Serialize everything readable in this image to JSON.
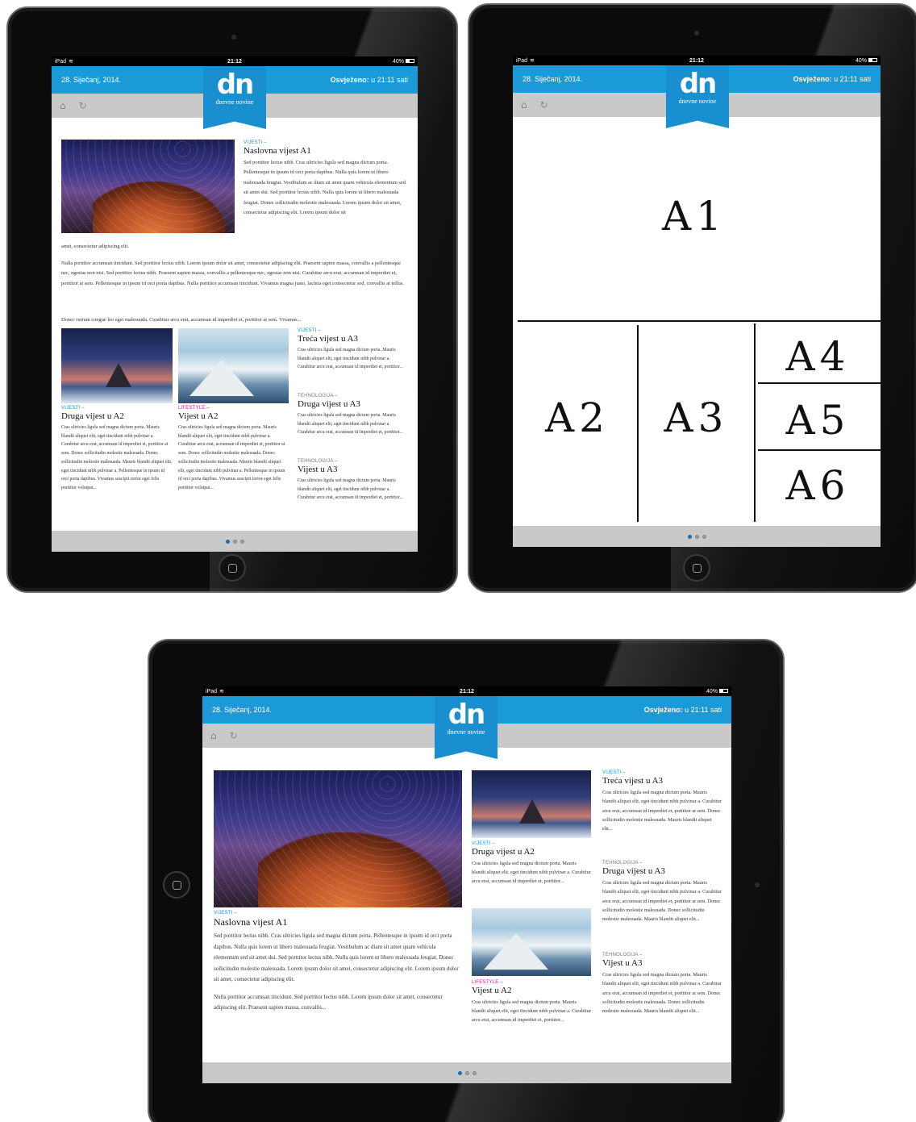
{
  "device": {
    "carrier": "iPad",
    "time": "21:12",
    "battery": "40%"
  },
  "app": {
    "date": "28. Siječanj, 2014.",
    "refresh_label": "Osvježeno:",
    "refresh_value": "u 21:11 sati",
    "logo_text": "dn",
    "logo_sub": "dnevne novine",
    "home_icon": "home-icon",
    "refresh_icon": "refresh-icon"
  },
  "articles": {
    "a1": {
      "category": "VIJESTI –",
      "title": "Naslovna vijest A1",
      "text_portrait": "Sed porttitor lectus nibh. Cras ultricies ligula sed magna dictum porta. Pellentesque in ipsum id orci porta dapibus. Nulla quis lorem ut libero malesuada feugiat. Vestibulum ac diam sit amet quam vehicula elementum sed sit amet dui. Sed porttitor lectus nibh. Nulla quis lorem ut libero malesuada feugiat. Donec sollicitudin molestie malesuada. Lorem ipsum dolor sit amet, consectetur adipiscing elit. Lorem ipsum dolor sit",
      "text_portrait_cont": "amet, consectetur adipiscing elit.",
      "para2": "Nulla porttitor accumsan tincidunt. Sed porttitor lectus nibh. Lorem ipsum dolor sit amet, consectetur adipiscing elit. Praesent sapien massa, convallis a pellentesque nec, egestas non nisi. Sed porttitor lectus nibh. Praesent sapien massa, convallis a pellentesque nec, egestas non nisi. Curabitur arcu erat, accumsan id imperdiet et, porttitor at sem. Pellentesque in ipsum id orci porta dapibus. Nulla porttitor accumsan tincidunt. Vivamus magna justo, lacinia eget consectetur sed, convallis at tellus.",
      "para3": "Donec rutrum congue leo eget malesuada. Curabitur arcu erat, accumsan id imperdiet et, porttitor at sem. Vivamus...",
      "text_landscape": "Sed porttitor lectus nibh. Cras ultricies ligula sed magna dictum porta. Pellentesque in ipsum id orci porta dapibus. Nulla quis lorem ut libero malesuada feugiat. Vestibulum ac diam sit amet quam vehicula elementum sed sit amet dui. Sed porttitor lectus nibh. Nulla quis lorem ut libero malesuada feugiat. Donec sollicitudin molestie malesuada. Lorem ipsum dolor sit amet, consectetur adipiscing elit. Lorem ipsum dolor sit amet, consectetur adipiscing elit.",
      "para2_landscape": "Nulla porttitor accumsan tincidunt. Sed porttitor lectus nibh. Lorem ipsum dolor sit amet, consectetur adipiscing elit. Praesent sapien massa, convallis..."
    },
    "druga_a2": {
      "category": "VIJESTI –",
      "title": "Druga vijest u A2",
      "text": "Cras ultricies ligula sed magna dictum porta. Mauris blandit aliquet elit, eget tincidunt nibh pulvinar a. Curabitur arcu erat, accumsan id imperdiet et, porttitor at sem. Donec sollicitudin molestie malesuada. Donec sollicitudin molestie malesuada. Mauris blandit aliquet elit, eget tincidunt nibh pulvinar a. Pellentesque in ipsum id orci porta dapibus. Vivamus suscipit tortor eget felis porttitor volutpat...",
      "text_short": "Cras ultricies ligula sed magna dictum porta. Mauris blandit aliquet elit, eget tincidunt nibh pulvinar a. Curabitur arcu erat, accumsan id imperdiet et, porttitor..."
    },
    "vijest_a2": {
      "category": "LIFESTYLE –",
      "title": "Vijest u A2",
      "text": "Cras ultricies ligula sed magna dictum porta. Mauris blandit aliquet elit, eget tincidunt nibh pulvinar a. Curabitur arcu erat, accumsan id imperdiet et, porttitor at sem. Donec sollicitudin molestie malesuada. Donec sollicitudin molestie malesuada. Mauris blandit aliquet elit, eget tincidunt nibh pulvinar a. Pellentesque in ipsum id orci porta dapibus. Vivamus suscipit tortor eget felis porttitor volutpat...",
      "text_short": "Cras ultricies ligula sed magna dictum porta. Mauris blandit aliquet elit, eget tincidunt nibh pulvinar a. Curabitur arcu erat, accumsan id imperdiet et, porttitor..."
    },
    "treca_a3": {
      "category": "VIJESTI –",
      "title": "Treća vijest u A3",
      "text": "Cras ultricies ligula sed magna dictum porta. Mauris blandit aliquet elit, eget tincidunt nibh pulvinar a. Curabitur arcu erat, accumsan id imperdiet et, porttitor...",
      "text_long": "Cras ultricies ligula sed magna dictum porta. Mauris blandit aliquet elit, eget tincidunt nibh pulvinar a. Curabitur arcu erat, accumsan id imperdiet et, porttitor at sem. Donec sollicitudin molestie malesuada. Mauris blandit aliquet elit..."
    },
    "druga_a3": {
      "category": "TEHNOLOGIJA –",
      "title": "Druga vijest u A3",
      "text": "Cras ultricies ligula sed magna dictum porta. Mauris blandit aliquet elit, eget tincidunt nibh pulvinar a. Curabitur arcu erat, accumsan id imperdiet et, porttitor...",
      "text_long": "Cras ultricies ligula sed magna dictum porta. Mauris blandit aliquet elit, eget tincidunt nibh pulvinar a. Curabitur arcu erat, accumsan id imperdiet et, porttitor at sem. Donec sollicitudin molestie malesuada. Donec sollicitudin molestie malesuada. Mauris blandit aliquet elit..."
    },
    "vijest_a3": {
      "category": "TEHNOLOGIJA –",
      "title": "Vijest u A3",
      "text": "Cras ultricies ligula sed magna dictum porta. Mauris blandit aliquet elit, eget tincidunt nibh pulvinar a. Curabitur arcu erat, accumsan id imperdiet et, porttitor...",
      "text_long": "Cras ultricies ligula sed magna dictum porta. Mauris blandit aliquet elit, eget tincidunt nibh pulvinar a. Curabitur arcu erat, accumsan id imperdiet et, porttitor at sem. Donec sollicitudin molestie malesuada. Donec sollicitudin molestie malesuada. Mauris blandit aliquet elit..."
    }
  },
  "layout_labels": {
    "a1": "A1",
    "a2": "A2",
    "a3": "A3",
    "a4": "A4",
    "a5": "A5",
    "a6": "A6"
  },
  "pager": {
    "pages": 3,
    "active": 1
  },
  "colors": {
    "brand_blue": "#1a9ad6",
    "toolbar_gray": "#c9c9c9",
    "lifestyle_pink": "#c2258c"
  }
}
